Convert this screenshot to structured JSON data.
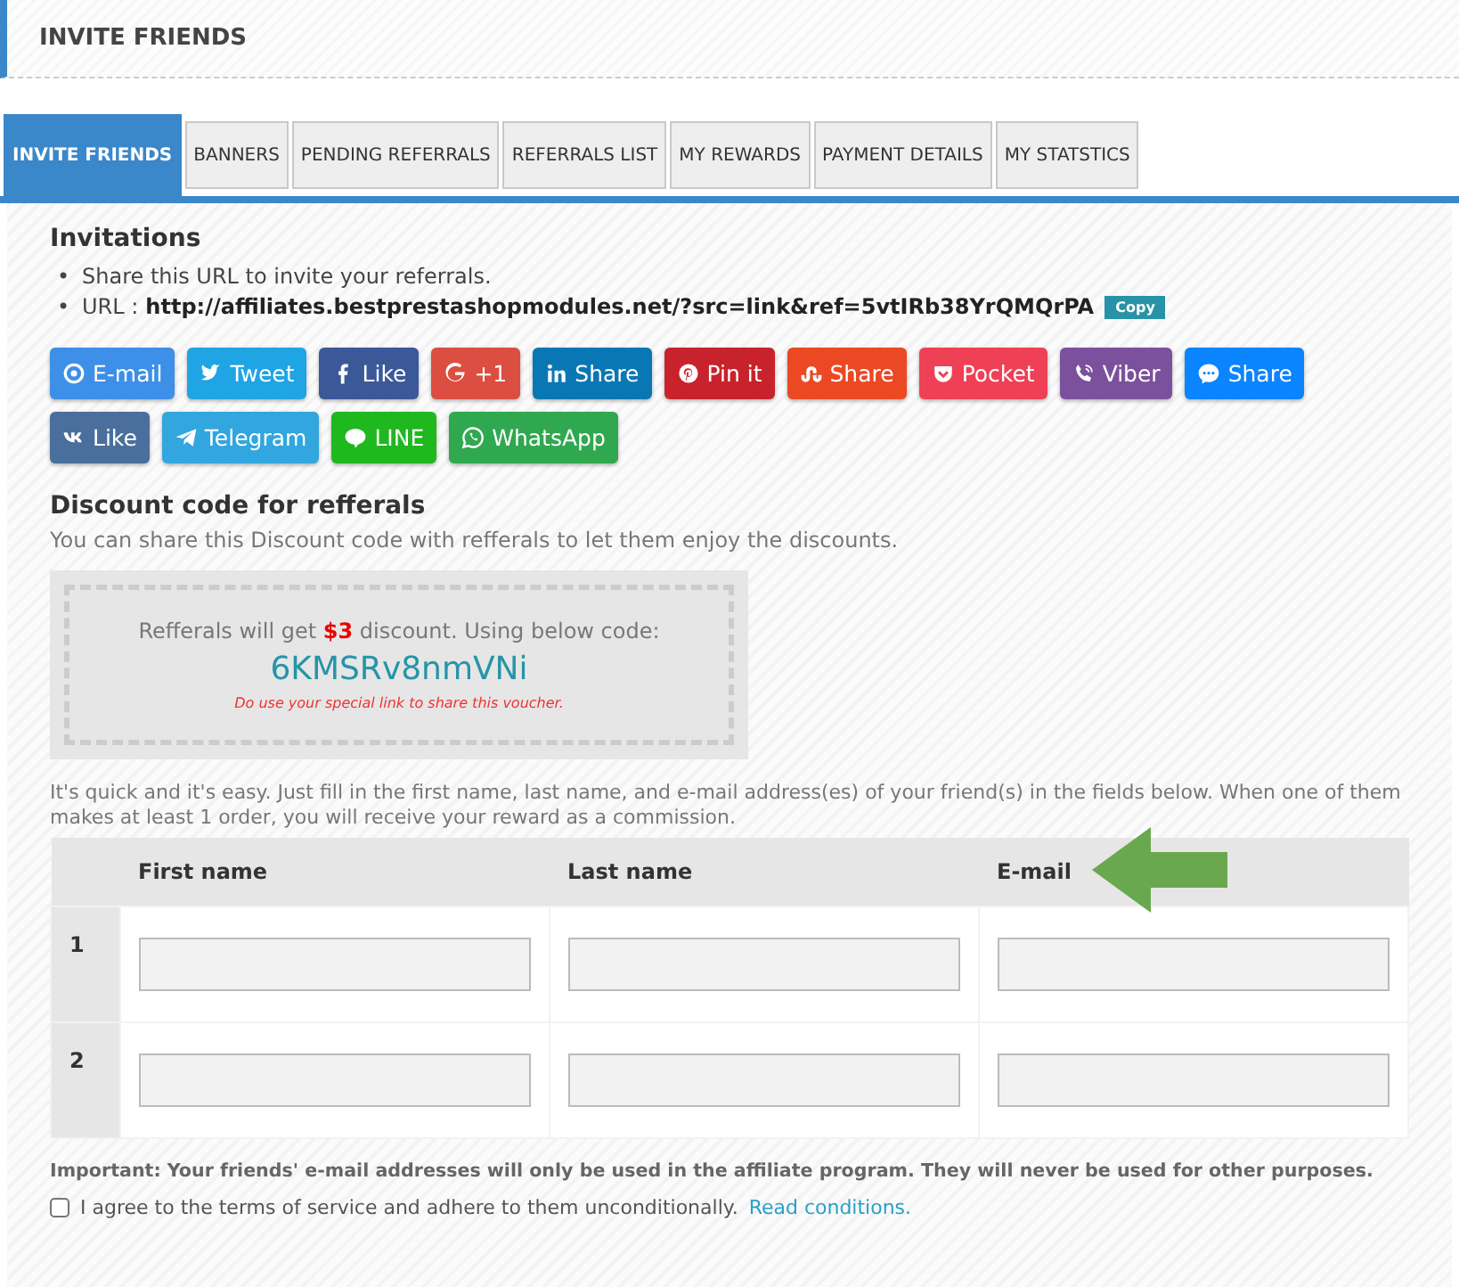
{
  "header": {
    "title": "INVITE FRIENDS"
  },
  "tabs": [
    {
      "label": "INVITE FRIENDS",
      "selected": true
    },
    {
      "label": "BANNERS",
      "selected": false
    },
    {
      "label": "PENDING REFERRALS",
      "selected": false
    },
    {
      "label": "REFERRALS LIST",
      "selected": false
    },
    {
      "label": "MY REWARDS",
      "selected": false
    },
    {
      "label": "PAYMENT DETAILS",
      "selected": false
    },
    {
      "label": "MY STATSTICS",
      "selected": false
    }
  ],
  "invitations": {
    "title": "Invitations",
    "bullet": "•",
    "share_hint": "Share this URL to invite your referrals.",
    "url_label": "URL :",
    "url": "http://affiliates.bestprestashopmodules.net/?src=link&ref=5vtIRb38YrQMQrPA",
    "copy_button": "Copy"
  },
  "share_buttons": [
    [
      {
        "kind": "email",
        "label": "E-mail",
        "color": "#3d8fe8"
      },
      {
        "kind": "twitter",
        "label": "Tweet",
        "color": "#1fa5e4"
      },
      {
        "kind": "facebook",
        "label": "Like",
        "color": "#3b5998"
      },
      {
        "kind": "googleplus",
        "label": "+1",
        "color": "#dc4e41"
      },
      {
        "kind": "linkedin",
        "label": "Share",
        "color": "#0a77b5"
      },
      {
        "kind": "pinterest",
        "label": "Pin it",
        "color": "#c8232c"
      },
      {
        "kind": "stumbleupon",
        "label": "Share",
        "color": "#eb4924"
      },
      {
        "kind": "pocket",
        "label": "Pocket",
        "color": "#ef4056"
      },
      {
        "kind": "viber",
        "label": "Viber",
        "color": "#7b519d"
      },
      {
        "kind": "messenger",
        "label": "Share",
        "color": "#0a84ff"
      }
    ],
    [
      {
        "kind": "vk",
        "label": "Like",
        "color": "#4a6f9c"
      },
      {
        "kind": "telegram",
        "label": "Telegram",
        "color": "#32a6de"
      },
      {
        "kind": "line",
        "label": "LINE",
        "color": "#1fb81f"
      },
      {
        "kind": "whatsapp",
        "label": "WhatsApp",
        "color": "#2fa84f"
      }
    ]
  ],
  "discount": {
    "title": "Discount code for refferals",
    "description": "You can share this Discount code with refferals to let them enjoy the discounts.",
    "offer": "Refferals will get **$3** discount. Using below code:",
    "code": "6KMSRv8nmVNi",
    "warning": "Do use your special link to share this voucher."
  },
  "invite_form": {
    "intro": "It's quick and it's easy. Just fill in the first name, last name, and e-mail address(es) of your friend(s) in the fields below. When one of them makes at least 1 order, you will receive your reward as a commission.",
    "columns": [
      "First name",
      "Last name",
      "E-mail"
    ],
    "rows": [
      {
        "number": "1"
      },
      {
        "number": "2"
      }
    ],
    "important": "Important: Your friends' e-mail addresses will only be used in the affiliate program. They will never be used for other purposes.",
    "agree": {
      "checked": false,
      "text": "I agree to the terms of service and adhere to them unconditionally.",
      "link": "Read conditions."
    }
  }
}
